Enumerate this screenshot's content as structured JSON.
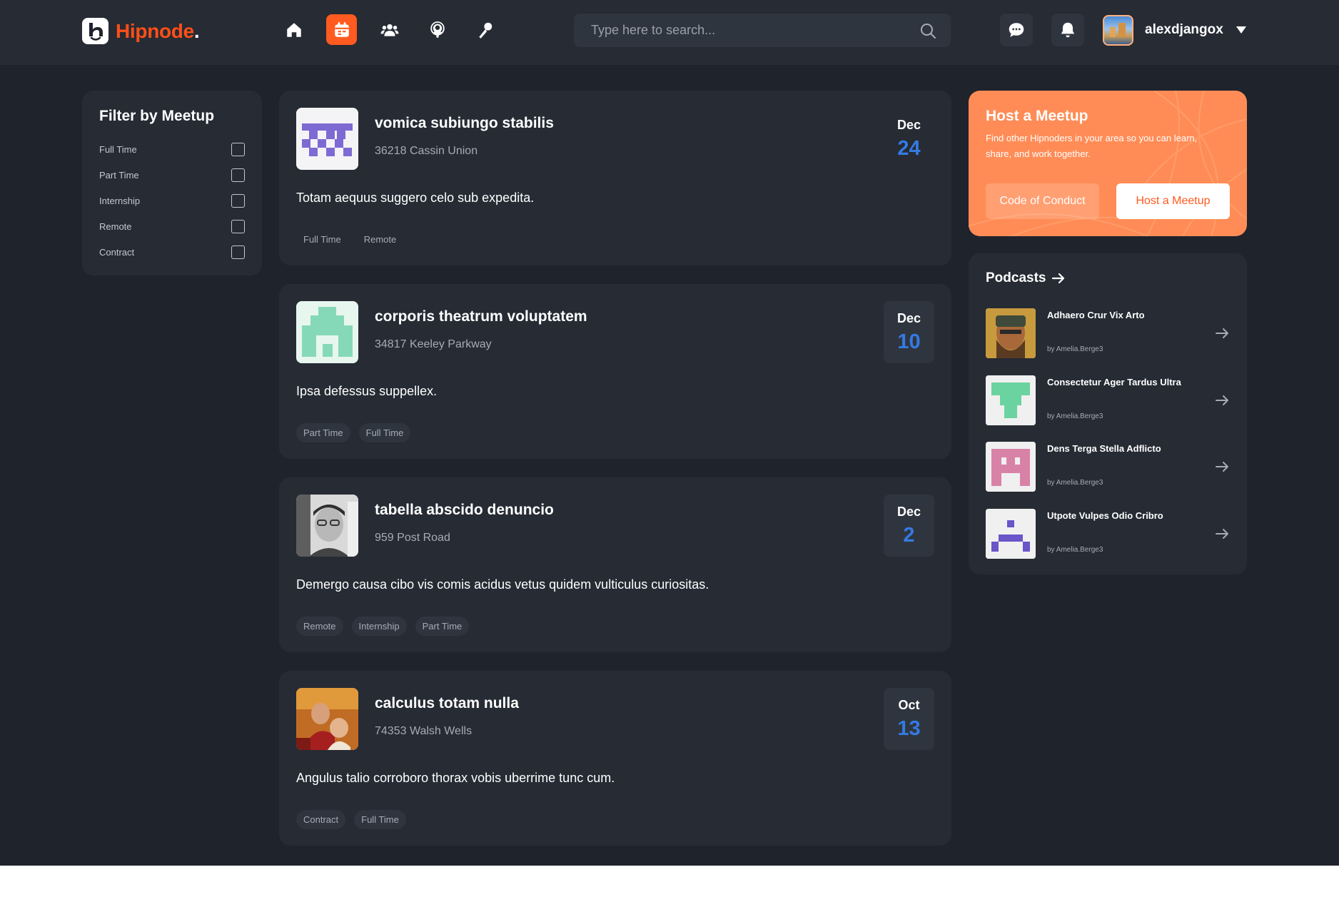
{
  "app": {
    "logo_text": "Hipnode",
    "logo_dot": "."
  },
  "nav": {
    "items": [
      {
        "icon": "home-icon",
        "active": false
      },
      {
        "icon": "calendar-icon",
        "active": true
      },
      {
        "icon": "groups-icon",
        "active": false
      },
      {
        "icon": "podcast-icon",
        "active": false
      },
      {
        "icon": "microphone-icon",
        "active": false
      }
    ]
  },
  "search": {
    "placeholder": "Type here to search..."
  },
  "user": {
    "name": "alexdjangox"
  },
  "filter": {
    "title": "Filter by Meetup",
    "options": [
      {
        "label": "Full Time",
        "checked": false
      },
      {
        "label": "Part Time",
        "checked": false
      },
      {
        "label": "Internship",
        "checked": false
      },
      {
        "label": "Remote",
        "checked": false
      },
      {
        "label": "Contract",
        "checked": false
      }
    ]
  },
  "meetups": [
    {
      "title": "vomica subiungo stabilis",
      "address": "36218 Cassin Union",
      "month": "Dec",
      "day": "24",
      "description": "Totam aequus suggero celo sub expedita.",
      "tags": [
        "Full Time",
        "Remote"
      ]
    },
    {
      "title": "corporis theatrum voluptatem",
      "address": "34817 Keeley Parkway",
      "month": "Dec",
      "day": "10",
      "description": "Ipsa defessus suppellex.",
      "tags": [
        "Part Time",
        "Full Time"
      ]
    },
    {
      "title": "tabella abscido denuncio",
      "address": "959 Post Road",
      "month": "Dec",
      "day": "2",
      "description": "Demergo causa cibo vis comis acidus vetus quidem vulticulus curiositas.",
      "tags": [
        "Remote",
        "Internship",
        "Part Time"
      ]
    },
    {
      "title": "calculus totam nulla",
      "address": "74353 Walsh Wells",
      "month": "Oct",
      "day": "13",
      "description": "Angulus talio corroboro thorax vobis uberrime tunc cum.",
      "tags": [
        "Contract",
        "Full Time"
      ]
    }
  ],
  "host": {
    "title": "Host a Meetup",
    "description": "Find other Hipnoders in your area so you can learn, share, and work together.",
    "coc_label": "Code of Conduct",
    "host_label": "Host a Meetup"
  },
  "podcasts": {
    "title": "Podcasts",
    "items": [
      {
        "title": "Adhaero Crur Vix Arto",
        "author": "by Amelia.Berge3"
      },
      {
        "title": "Consectetur Ager Tardus Ultra",
        "author": "by Amelia.Berge3"
      },
      {
        "title": "Dens Terga Stella Adflicto",
        "author": "by Amelia.Berge3"
      },
      {
        "title": "Utpote Vulpes Odio Cribro",
        "author": "by Amelia.Berge3"
      }
    ]
  },
  "colors": {
    "brand": "#ff4f17",
    "accent": "#ff5a1f",
    "date_blue": "#347ae2",
    "host_card": "#ff8c56"
  }
}
